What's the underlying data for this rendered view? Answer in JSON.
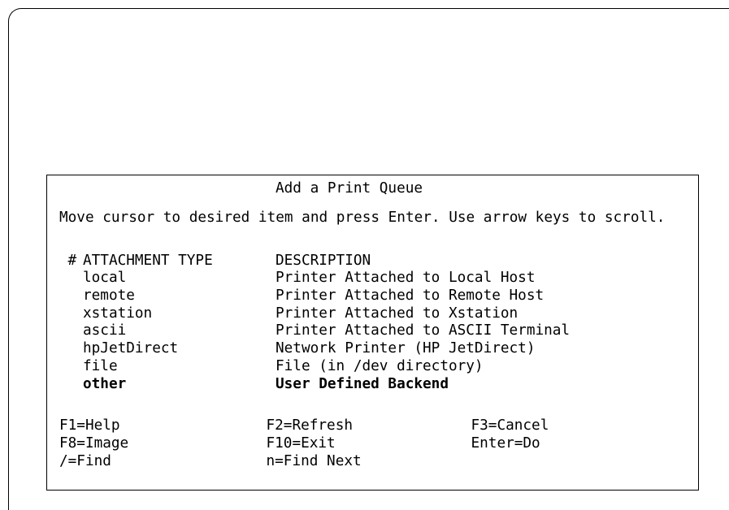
{
  "colors": {
    "foreground": "#000000",
    "background": "#ffffff"
  },
  "dialog": {
    "title": "Add a Print Queue",
    "instruction": "Move cursor to desired item and press Enter. Use arrow keys to scroll."
  },
  "list": {
    "header": {
      "marker": "#",
      "type": "ATTACHMENT TYPE",
      "description": "DESCRIPTION"
    },
    "rows": [
      {
        "type": "local",
        "description": "Printer Attached to Local Host",
        "selected": false
      },
      {
        "type": "remote",
        "description": "Printer Attached to Remote Host",
        "selected": false
      },
      {
        "type": "xstation",
        "description": "Printer Attached to Xstation",
        "selected": false
      },
      {
        "type": "ascii",
        "description": "Printer Attached to ASCII Terminal",
        "selected": false
      },
      {
        "type": "hpJetDirect",
        "description": "Network Printer (HP JetDirect)",
        "selected": false
      },
      {
        "type": "file",
        "description": "File (in /dev directory)",
        "selected": false
      },
      {
        "type": "other",
        "description": "User Defined Backend",
        "selected": true
      }
    ]
  },
  "function_keys": [
    "F1=Help",
    "F2=Refresh",
    "F3=Cancel",
    "F8=Image",
    "F10=Exit",
    "Enter=Do",
    "/=Find",
    "n=Find Next"
  ]
}
